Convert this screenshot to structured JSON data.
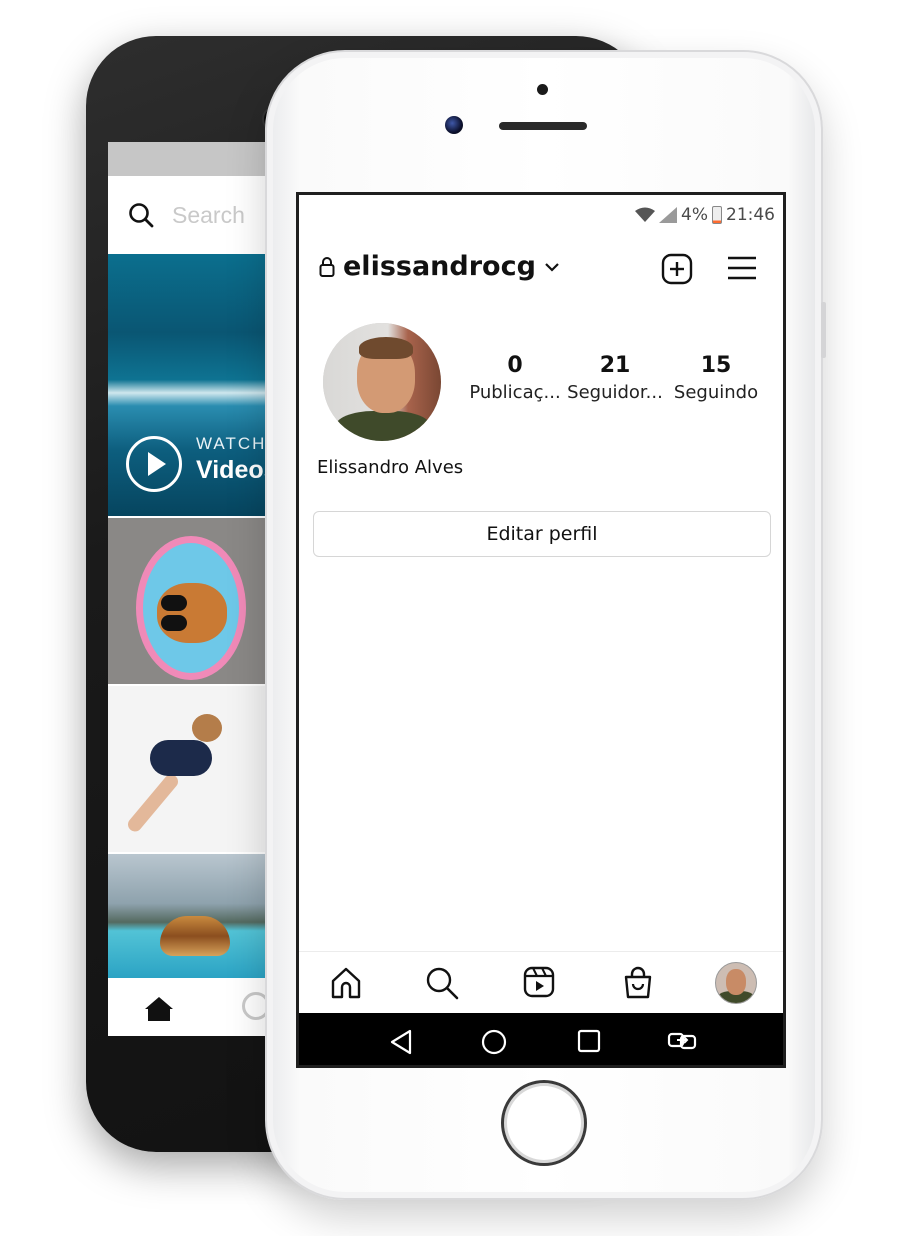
{
  "back_phone": {
    "search_placeholder": "Search",
    "watch_small": "WATCH",
    "watch_big": "Videos"
  },
  "status_bar": {
    "battery": "4%",
    "time": "21:46"
  },
  "profile": {
    "username": "elissandrocg",
    "full_name": "Elissandro Alves",
    "stats": [
      {
        "value": "0",
        "label": "Publicaç..."
      },
      {
        "value": "21",
        "label": "Seguidor..."
      },
      {
        "value": "15",
        "label": "Seguindo"
      }
    ],
    "edit_button": "Editar perfil"
  },
  "icons": {
    "header": [
      "lock-icon",
      "chevron-down-icon",
      "new-post-icon",
      "menu-icon"
    ],
    "tabbar": [
      "home-icon",
      "search-icon",
      "reels-icon",
      "shop-icon",
      "profile-avatar"
    ],
    "system_nav": [
      "back-icon",
      "home-circle-icon",
      "recents-icon",
      "switch-apps-icon"
    ]
  },
  "colors": {
    "text_primary": "#111111",
    "border": "#d6d6d6",
    "system_nav_bg": "#000000"
  }
}
